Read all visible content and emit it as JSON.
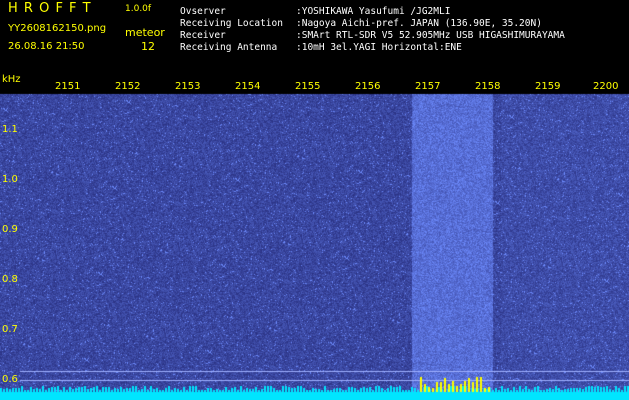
{
  "app": {
    "name": "H R O F F T",
    "version": "1.0.0f",
    "filename": "YY2608162150.png",
    "timestamp": "26.08.16 21:50",
    "mode_label": "meteor",
    "count": "12"
  },
  "info": {
    "labels": [
      "Ovserver",
      "Receiving Location",
      "Receiver",
      "Receiving Antenna"
    ],
    "values": [
      ":YOSHIKAWA Yasufumi /JG2MLI",
      ":Nagoya Aichi-pref. JAPAN (136.90E, 35.20N)",
      ":SMArt RTL-SDR V5 52.905MHz USB HIGASHIMURAYAMA",
      ":10mH 3el.YAGI Horizontal:ENE"
    ]
  },
  "axes": {
    "y_unit": "kHz",
    "y_ticks": [
      "1.1",
      "1.0",
      "0.9",
      "0.8",
      "0.7",
      "0.6"
    ],
    "x_ticks": [
      "2151",
      "2152",
      "2153",
      "2154",
      "2155",
      "2156",
      "2157",
      "2158",
      "2159",
      "2200"
    ]
  },
  "colors": {
    "background": "#000000",
    "text": "#ffff00",
    "info_text": "#ffffff",
    "noise_dark": "#0a0a5a",
    "noise_bright": "#4a6cff",
    "baseline": "#00e5ff"
  }
}
